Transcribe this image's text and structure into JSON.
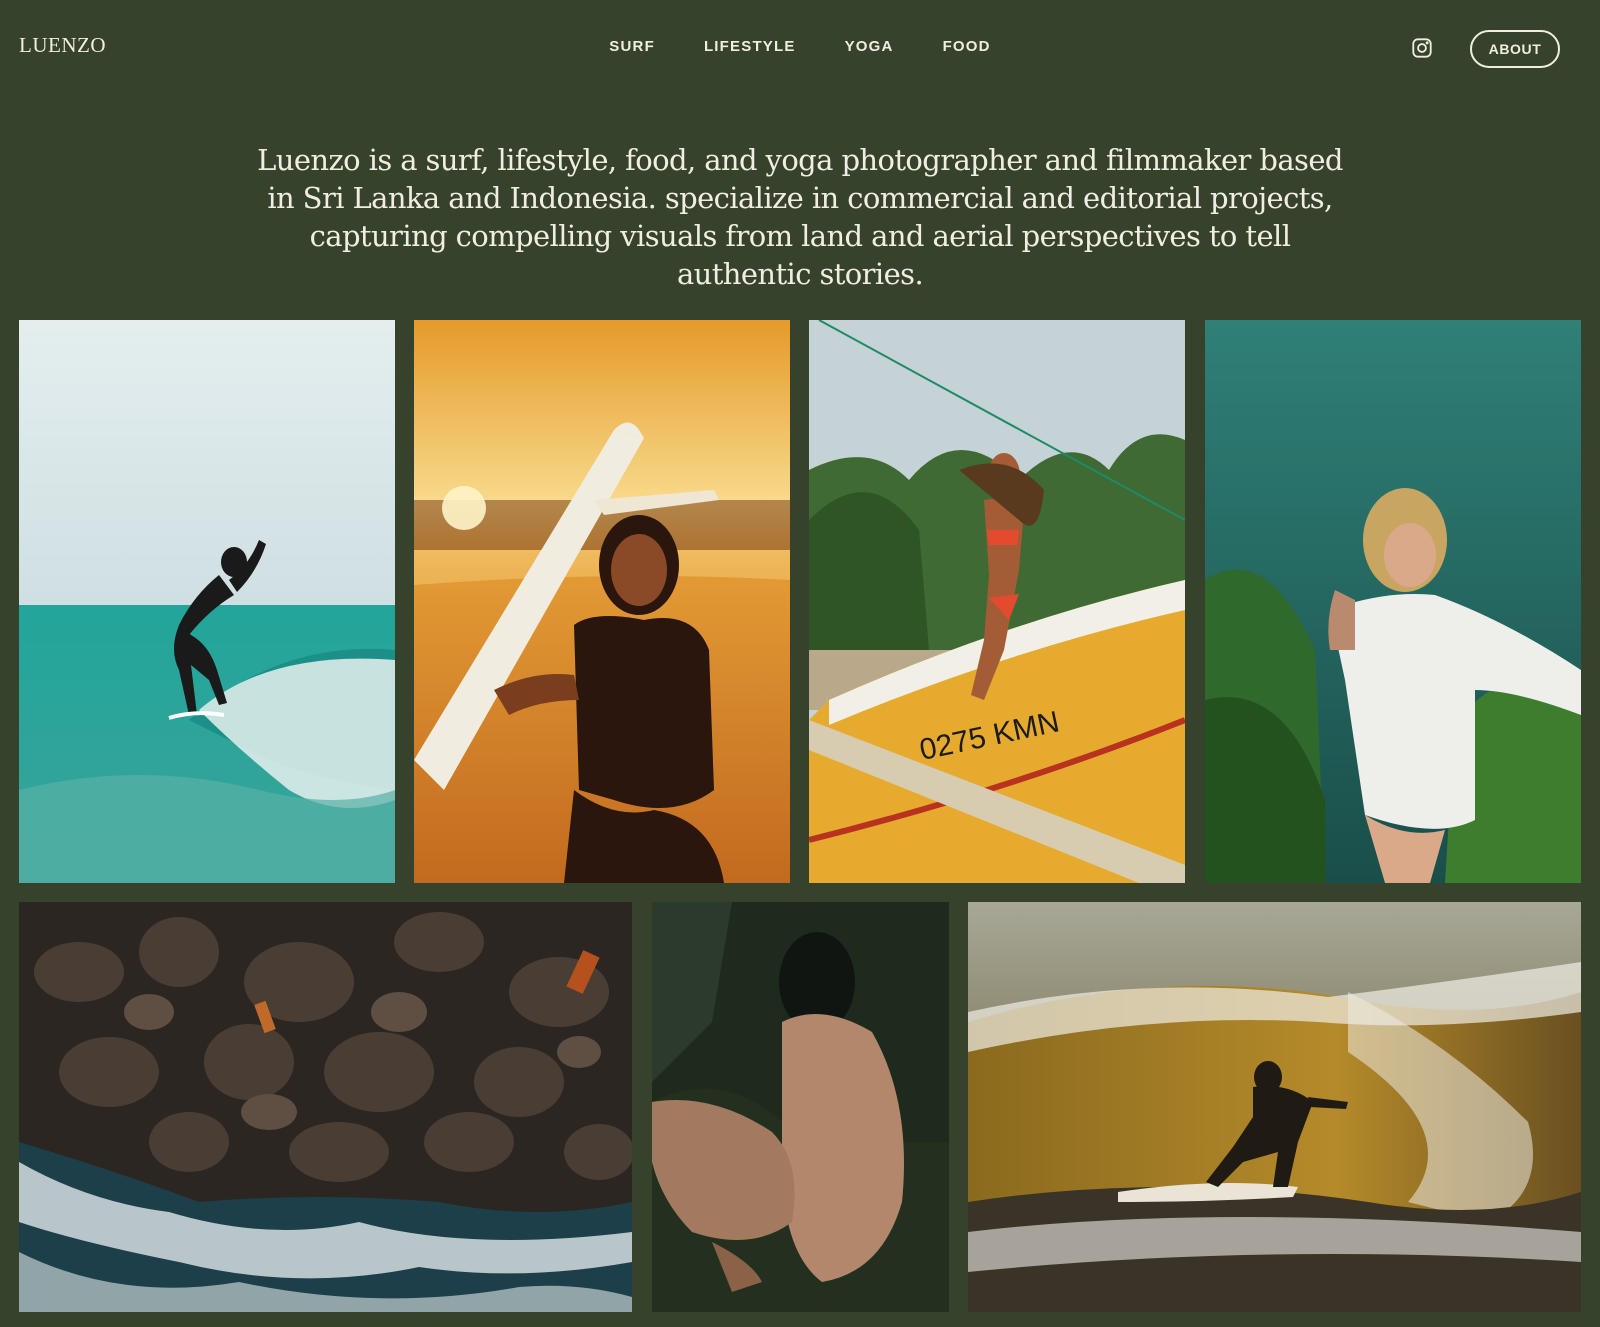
{
  "header": {
    "logo": "LUENZO",
    "nav": [
      {
        "label": "SURF"
      },
      {
        "label": "LIFESTYLE"
      },
      {
        "label": "YOGA"
      },
      {
        "label": "FOOD"
      }
    ],
    "instagram_icon": "instagram-icon",
    "about_label": "ABOUT"
  },
  "intro": {
    "text": "Luenzo is a surf, lifestyle, food, and yoga photographer and filmmaker based in Sri Lanka and Indonesia. specialize in commercial and editorial projects, capturing compelling visuals from land and aerial perspectives to tell authentic stories."
  },
  "gallery": {
    "photos": [
      {
        "name": "surfer-on-turquoise-wave",
        "sky": "#dfe9ea",
        "sea": "#1f9a8e"
      },
      {
        "name": "woman-with-surfboard-at-sunset",
        "sky": "#f2a93b",
        "sea": "#e8922f"
      },
      {
        "name": "woman-on-yellow-boat",
        "sky": "#c9d6db",
        "sea": "#e8b23a"
      },
      {
        "name": "woman-in-white-shirt-by-ocean",
        "sky": "#2f7d73",
        "sea": "#1f5a3a"
      },
      {
        "name": "aerial-rocks-and-surf",
        "sky": "#2e2a25",
        "sea": "#1d3a44"
      },
      {
        "name": "seated-figure-in-grass",
        "sky": "#1f2a1f",
        "sea": "#2e3a28"
      },
      {
        "name": "surfer-in-barrel-wave",
        "sky": "#8a8a78",
        "sea": "#7a5a1a"
      }
    ]
  },
  "colors": {
    "background": "#36422c",
    "text": "#f1ede2"
  }
}
